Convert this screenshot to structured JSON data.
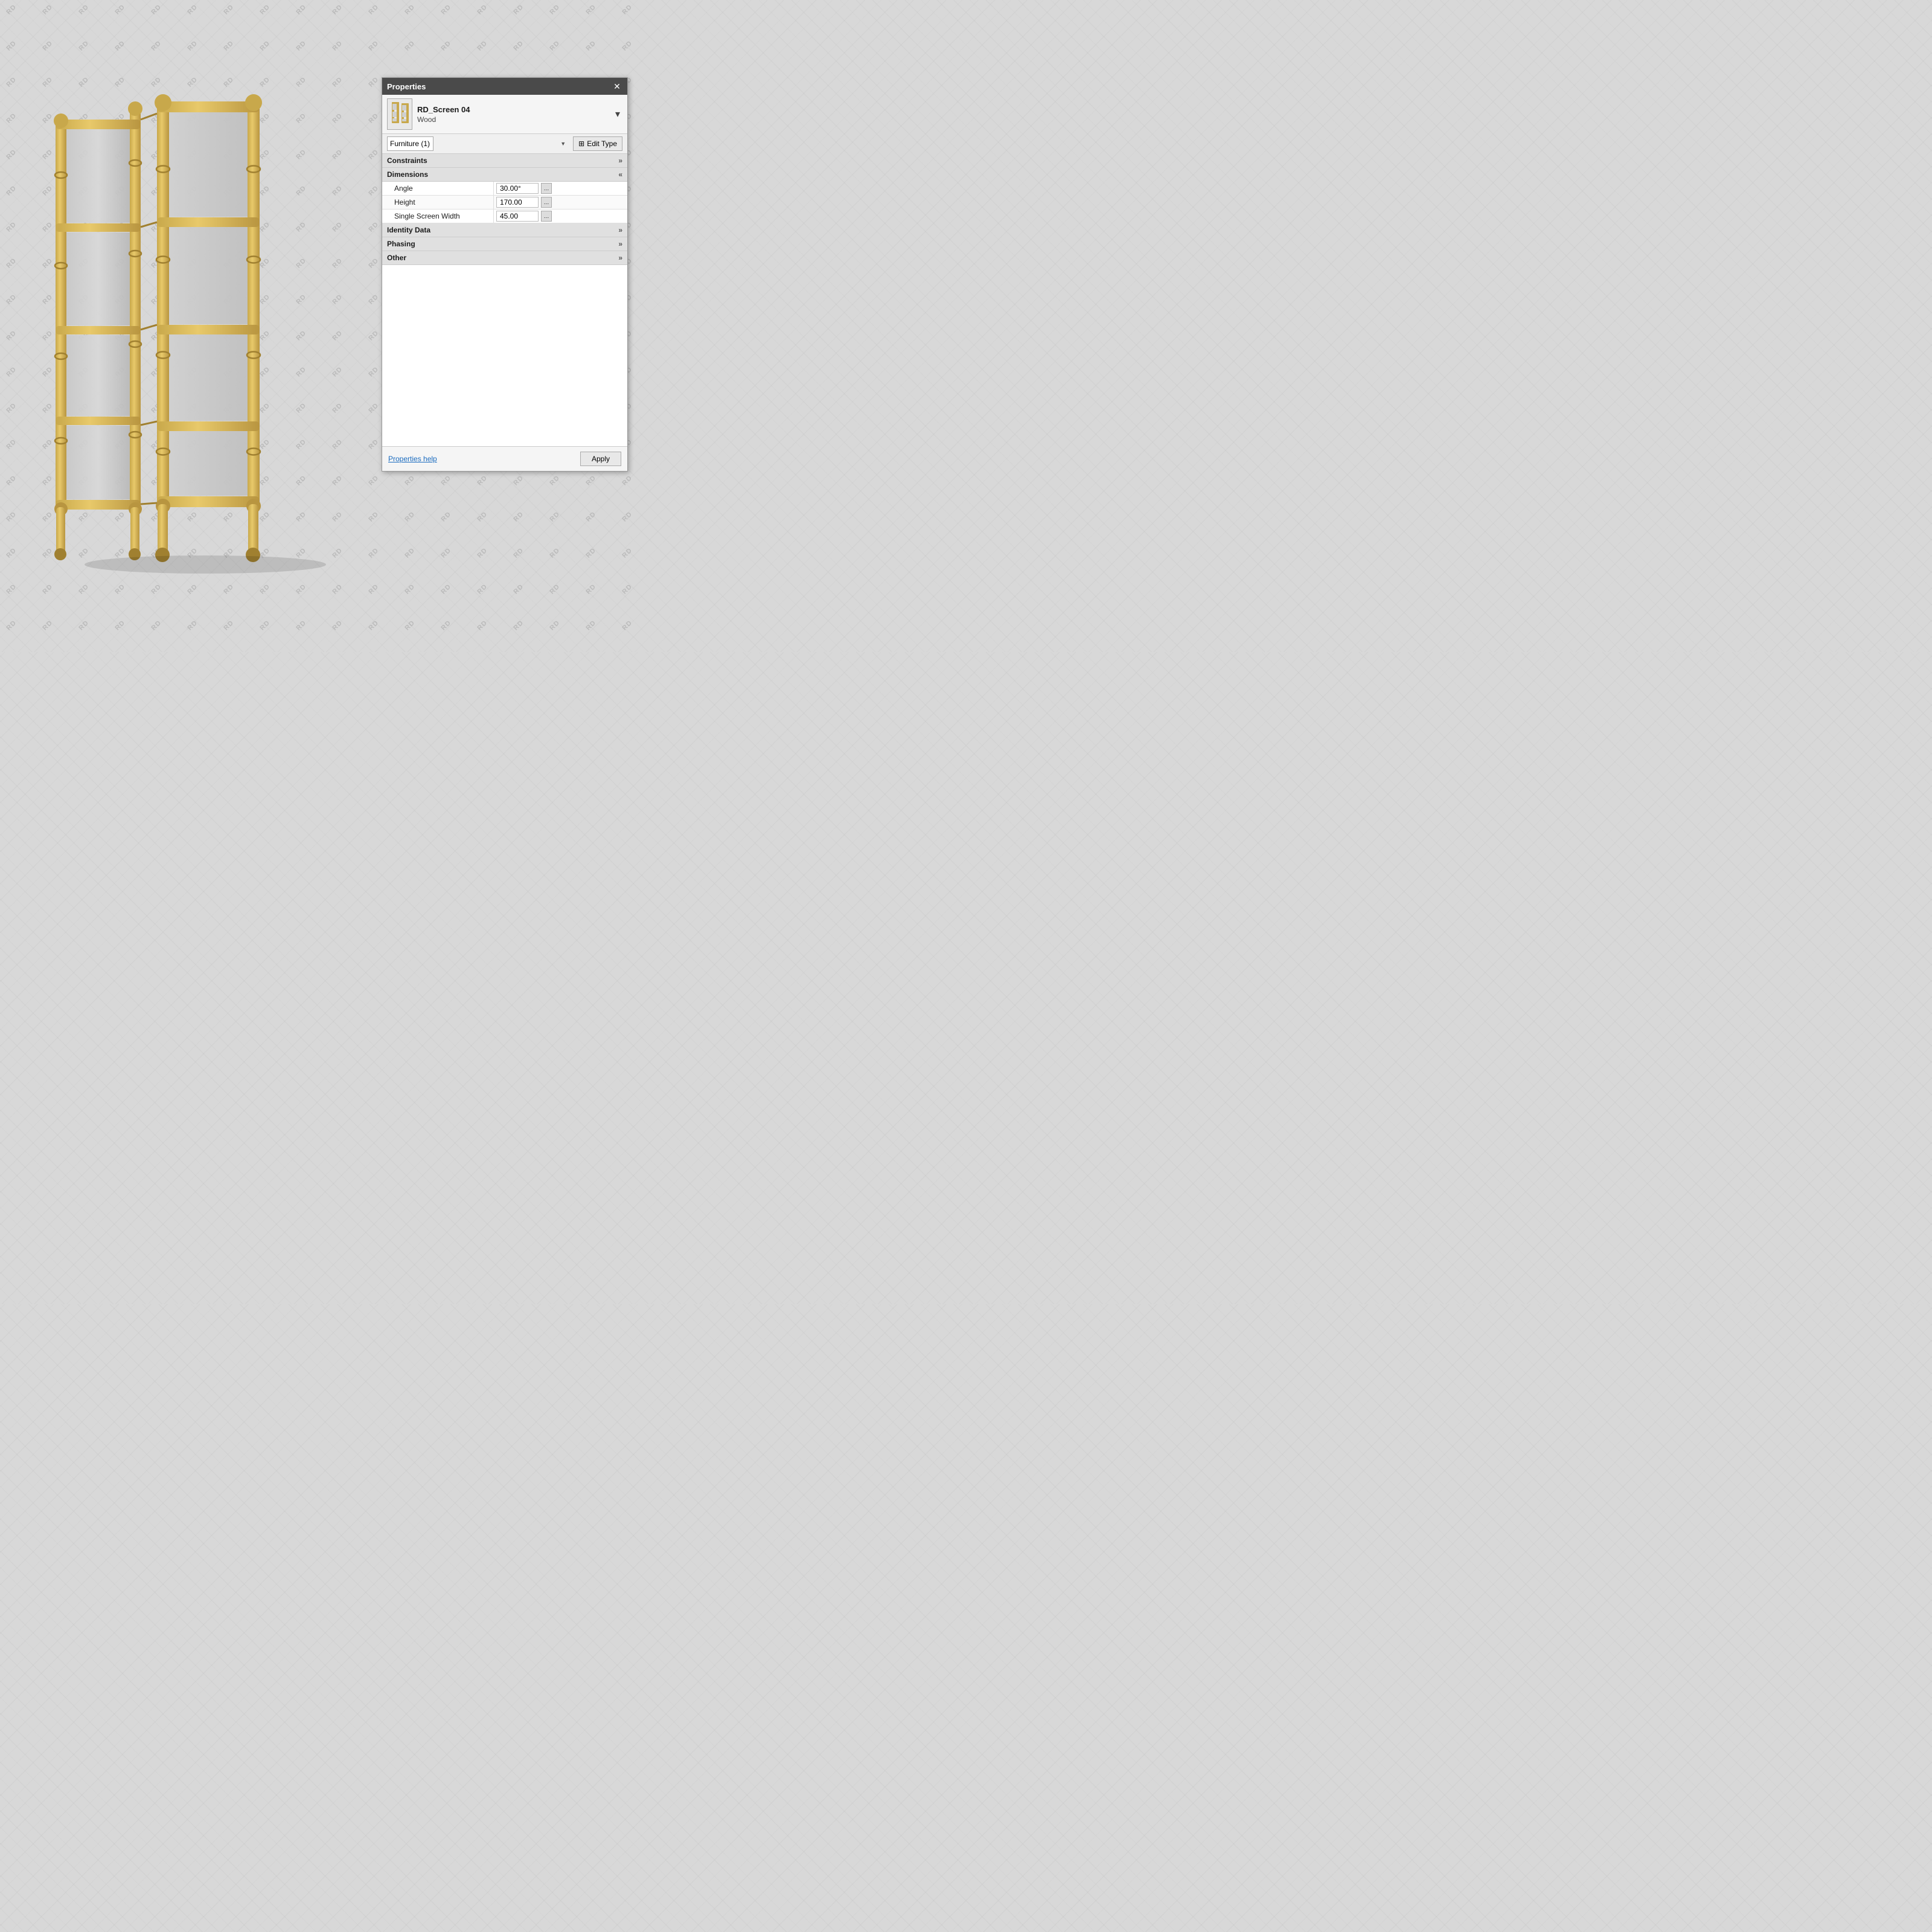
{
  "panel": {
    "title": "Properties",
    "close_label": "✕",
    "element": {
      "name": "RD_Screen 04",
      "subtype": "Wood",
      "dropdown_arrow": "▾"
    },
    "category": {
      "value": "Furniture (1)",
      "edit_type_label": "Edit Type"
    },
    "sections": [
      {
        "id": "constraints",
        "label": "Constraints",
        "collapsed": true,
        "toggle": "»",
        "rows": []
      },
      {
        "id": "dimensions",
        "label": "Dimensions",
        "collapsed": false,
        "toggle": "«",
        "rows": [
          {
            "label": "Angle",
            "value": "30.00°"
          },
          {
            "label": "Height",
            "value": "170.00"
          },
          {
            "label": "Single Screen Width",
            "value": "45.00"
          }
        ]
      },
      {
        "id": "identity",
        "label": "Identity Data",
        "collapsed": true,
        "toggle": "»",
        "rows": []
      },
      {
        "id": "phasing",
        "label": "Phasing",
        "collapsed": true,
        "toggle": "»",
        "rows": []
      },
      {
        "id": "other",
        "label": "Other",
        "collapsed": true,
        "toggle": "»",
        "rows": []
      }
    ],
    "footer": {
      "help_label": "Properties help",
      "apply_label": "Apply"
    }
  },
  "watermark": {
    "text": "RD"
  },
  "icons": {
    "edit_type": "⊞",
    "expand": "«",
    "collapse": "»"
  }
}
